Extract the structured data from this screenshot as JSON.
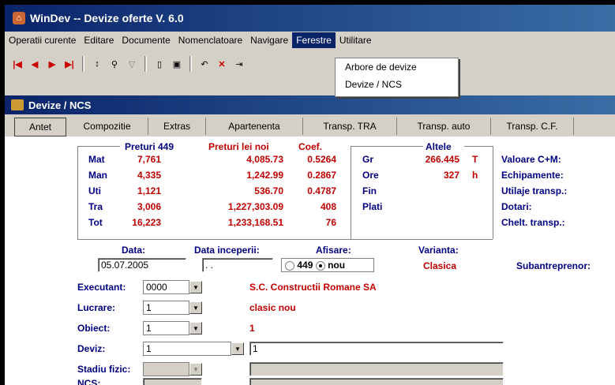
{
  "app": {
    "title": "WinDev -- Devize oferte V. 6.0"
  },
  "menu": [
    "Operatii curente",
    "Editare",
    "Documente",
    "Nomenclatoare",
    "Navigare",
    "Ferestre",
    "Utilitare"
  ],
  "dropdown": {
    "items": [
      "Arbore de devize",
      "Devize / NCS"
    ]
  },
  "child": {
    "title": "Devize / NCS"
  },
  "tabs": [
    "Antet",
    "Compozitie",
    "Extras",
    "Apartenenta",
    "Transp. TRA",
    "Transp. auto",
    "Transp. C.F."
  ],
  "prices": {
    "headers": {
      "p449": "Preturi 449",
      "noi": "Preturi lei noi",
      "coef": "Coef.",
      "altele": "Altele"
    },
    "rows": [
      {
        "label": "Mat",
        "p449": "7,761",
        "noi": "4,085.73",
        "coef": "0.5264"
      },
      {
        "label": "Man",
        "p449": "4,335",
        "noi": "1,242.99",
        "coef": "0.2867"
      },
      {
        "label": "Uti",
        "p449": "1,121",
        "noi": "536.70",
        "coef": "0.4787"
      },
      {
        "label": "Tra",
        "p449": "3,006",
        "noi": "1,227,303.09",
        "coef": "408"
      },
      {
        "label": "Tot",
        "p449": "16,223",
        "noi": "1,233,168.51",
        "coef": "76"
      }
    ],
    "altele": [
      {
        "label": "Gr",
        "value": "266.445",
        "unit": "T"
      },
      {
        "label": "Ore",
        "value": "327",
        "unit": "h"
      },
      {
        "label": "Fin",
        "value": "",
        "unit": ""
      },
      {
        "label": "Plati",
        "value": "",
        "unit": ""
      }
    ],
    "right": [
      "Valoare C+M:",
      "Echipamente:",
      "Utilaje transp.:",
      "Dotari:",
      "Chelt. transp.:"
    ]
  },
  "form": {
    "data_label": "Data:",
    "data_value": "05.07.2005",
    "data_incep_label": "Data inceperii:",
    "data_incep_value": ". .",
    "afisare_label": "Afisare:",
    "opt449": "449",
    "optnou": "nou",
    "varianta_label": "Varianta:",
    "varianta_value": "Clasica",
    "subantreprenor_label": "Subantreprenor:",
    "executant_label": "Executant:",
    "executant_value": "0000",
    "executant_text": "S.C. Constructii Romane SA",
    "lucrare_label": "Lucrare:",
    "lucrare_value": "1",
    "lucrare_text": "clasic nou",
    "obiect_label": "Obiect:",
    "obiect_value": "1",
    "obiect_text": "1",
    "deviz_label": "Deviz:",
    "deviz_value": "1",
    "deviz_text": "1",
    "stadiu_label": "Stadiu fizic:",
    "ncs_label": "NCS:"
  },
  "colors": {
    "title": "#0a246a",
    "accent_red": "#c00000",
    "label_blue": "#000080"
  }
}
